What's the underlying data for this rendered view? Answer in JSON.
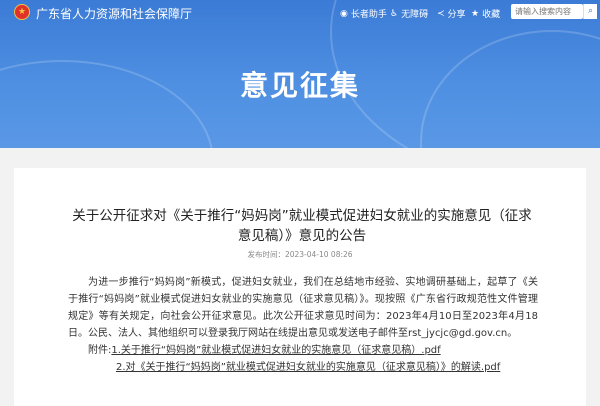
{
  "header": {
    "site_name": "广东省人力资源和社会保障厅",
    "toolbar": [
      {
        "label": "长者助手",
        "icon": "elderly-assist-icon",
        "glyph": "◉"
      },
      {
        "label": "无障碍",
        "icon": "accessibility-icon",
        "glyph": "♿"
      },
      {
        "label": "分享",
        "icon": "share-icon",
        "glyph": "≺"
      },
      {
        "label": "收藏",
        "icon": "favorite-icon",
        "glyph": "★"
      }
    ],
    "search_placeholder": "请输入搜索内容",
    "banner_title": "意见征集",
    "colors": {
      "banner": "#3b7bd6",
      "emblem": "#e0312a"
    }
  },
  "article": {
    "title": "关于公开征求对《关于推行“妈妈岗”就业模式促进妇女就业的实施意见（征求意见稿）》意见的公告",
    "publish_time": "发布时间：2023-04-10 08:26",
    "paragraphs": [
      "为进一步推行“妈妈岗”新模式，促进妇女就业，我们在总结地市经验、实地调研基础上，起草了《关于推行“妈妈岗”就业模式促进妇女就业的实施意见（征求意见稿）》。现按照《广东省行政规范性文件管理规定》等有关规定，向社会公开征求意见。此次公开征求意见时间为：2023年4月10日至2023年4月18日。",
      "公民、法人、其他组织可以登录我厅网站在线提出意见或发送电子邮件至rst_jycjc@gd.gov.cn。"
    ],
    "attachments_prefix": "附件:",
    "attachments": [
      "1.关于推行“妈妈岗”就业模式促进妇女就业的实施意见（征求意见稿）.pdf",
      "2.对《关于推行“妈妈岗”就业模式促进妇女就业的实施意见（征求意见稿）》的解读.pdf"
    ]
  }
}
